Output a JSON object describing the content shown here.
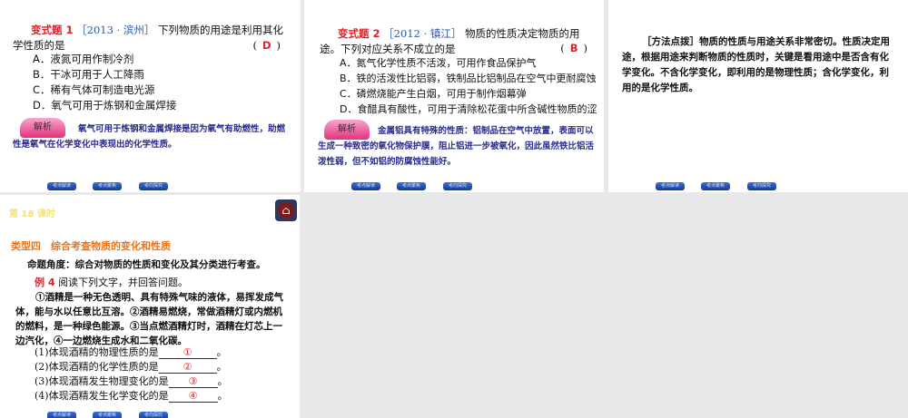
{
  "nav_buttons": [
    "考点解读",
    "考点聚焦",
    "考向探究"
  ],
  "slide1": {
    "label": "变式题 1",
    "source": "［2013 · 滨州］",
    "question": "下列物质的用途是利用其化学性质的是",
    "answer": "D",
    "options": [
      "A．液氮可用作制冷剂",
      "B．干冰可用于人工降雨",
      "C．稀有气体可制造电光源",
      "D．氧气可用于炼钢和金属焊接"
    ],
    "jie_label": "解析",
    "explanation": "氧气可用于炼钢和金属焊接是因为氧气有助燃性，助燃性是氧气在化学变化中表现出的化学性质。"
  },
  "slide2": {
    "label": "变式题 2",
    "source": "［2012 · 镇江］",
    "question": "物质的性质决定物质的用途。下列对应关系不成立的是",
    "answer": "B",
    "options": [
      "A．氮气化学性质不活泼，可用作食品保护气",
      "B．铁的活泼性比铝弱，铁制品比铝制品在空气中更耐腐蚀",
      "C．磷燃烧能产生白烟，可用于制作烟幕弹",
      "D．食醋具有酸性，可用于清除松花蛋中所含碱性物质的涩味"
    ],
    "jie_label": "解析",
    "explanation": "金属铝具有特殊的性质：铝制品在空气中放置，表面可以生成一种致密的氧化物保护膜，阻止铝进一步被氧化，因此虽然铁比铝活泼性弱，但不如铝的防腐蚀性能好。"
  },
  "slide3": {
    "label": "［方法点拨］",
    "text": "物质的性质与用途关系非常密切。性质决定用途，根据用途来判断物质的性质时，关键是看用途中是否含有化学变化。不含化学变化，即利用的是物理性质；含化学变化，利用的是化学性质。"
  },
  "slide4": {
    "lesson": "第 18 课时",
    "home_icon": "home",
    "heading": "类型四　综合考查物质的变化和性质",
    "angle": "命题角度：综合对物质的性质和变化及其分类进行考查。",
    "example_label": "例 4",
    "example_prompt": "阅读下列文字，并回答问题。",
    "passage": "①酒精是一种无色透明、具有特殊气味的液体，易挥发成气体，能与水以任意比互溶。②酒精易燃烧，常做酒精灯或内燃机的燃料，是一种绿色能源。③当点燃酒精灯时，酒精在灯芯上一边汽化，④一边燃烧生成水和二氧化碳。",
    "questions": [
      {
        "q": "(1)体现酒精的物理性质的是",
        "blank": "①"
      },
      {
        "q": "(2)体现酒精的化学性质的是",
        "blank": "②"
      },
      {
        "q": "(3)体现酒精发生物理变化的是",
        "blank": "③"
      },
      {
        "q": "(4)体现酒精发生化学变化的是",
        "blank": "④"
      }
    ],
    "period": "。"
  }
}
